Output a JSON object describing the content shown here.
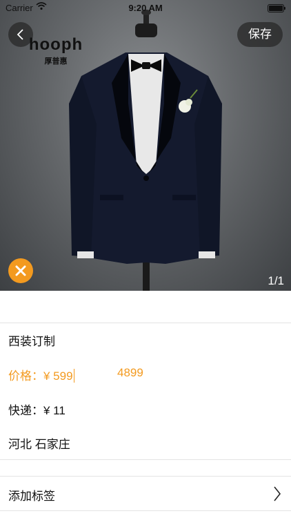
{
  "status_bar": {
    "carrier": "Carrier",
    "time": "9:20 AM"
  },
  "header": {
    "save_label": "保存"
  },
  "brand": {
    "name": "hooph",
    "subtitle": "厚普惠"
  },
  "gallery": {
    "page_indicator": "1/1"
  },
  "product": {
    "title": "西装订制",
    "price_label": "价格：¥ 599",
    "original_price": "4899",
    "express_label": "快递：¥ 11",
    "location": "河北 石家庄"
  },
  "tag_row": {
    "label": "添加标签"
  },
  "colors": {
    "accent": "#f39a1f",
    "divider": "#e3e3e3"
  },
  "icons": [
    "back-chevron-icon",
    "wifi-icon",
    "battery-icon",
    "close-icon",
    "chevron-right-icon"
  ]
}
